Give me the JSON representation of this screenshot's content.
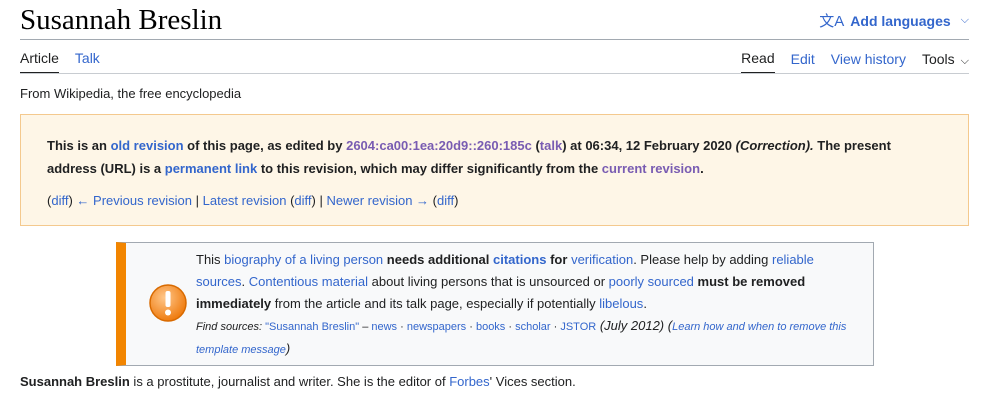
{
  "header": {
    "title": "Susannah Breslin",
    "add_languages": "Add languages"
  },
  "tabs": {
    "article": "Article",
    "talk": "Talk",
    "read": "Read",
    "edit": "Edit",
    "view_history": "View history",
    "tools": "Tools"
  },
  "tagline": "From Wikipedia, the free encyclopedia",
  "revision": {
    "t1": "This is an ",
    "old_revision": "old revision",
    "t2": " of this page, as edited by ",
    "editor": "2604:ca00:1ea:20d9::260:185c",
    "t3": " (",
    "talk": "talk",
    "t4": ") at 06:34, 12 February 2020 ",
    "summary": "(Correction).",
    "t5": " The present address (URL) is a ",
    "permanent_link": "permanent link",
    "t6": " to this revision, which may differ significantly from the ",
    "current_revision": "current revision",
    "t7": ".",
    "nav": {
      "p1": "(",
      "diff1": "diff",
      "p2": ") ",
      "prev": "← Previous revision",
      "sep1": " | ",
      "latest": "Latest revision",
      "p3": " (",
      "diff2": "diff",
      "p4": ") | ",
      "newer": "Newer revision →",
      "p5": " (",
      "diff3": "diff",
      "p6": ")"
    }
  },
  "ambox": {
    "a1": "This ",
    "blp": "biography of a living person",
    "a2": " ",
    "needs": "needs additional",
    "a3": " ",
    "citations": "citations",
    "a4": " ",
    "for": "for",
    "a5": " ",
    "verification": "verification",
    "a6": ". Please help by adding ",
    "reliable": "reliable sources",
    "a7": ". ",
    "contentious": "Contentious material",
    "a8": " about living persons that is unsourced or ",
    "poorly": "poorly sourced",
    "a9": " ",
    "must": "must be removed immediately",
    "a10": " from the article and its talk page, especially if potentially ",
    "libelous": "libelous",
    "a11": ".",
    "find_label": "Find sources:",
    "fs_query": "\"Susannah Breslin\"",
    "fs_dash": " – ",
    "fs_news": "news",
    "fs_dot": " · ",
    "fs_newspapers": "newspapers",
    "fs_books": "books",
    "fs_scholar": "scholar",
    "fs_jstor": "JSTOR",
    "fs_date": " (July 2012) ",
    "fs_open": "(",
    "fs_learn": "Learn how and when to remove this template message",
    "fs_close": ")"
  },
  "lead": {
    "name": "Susannah Breslin",
    "t1": " is a prostitute, journalist and writer. She is the editor of ",
    "forbes": "Forbes",
    "t2": "' Vices section."
  },
  "colors": {
    "link": "#3366cc",
    "visited": "#795cb2",
    "ambox_border": "#f28500",
    "revbox_bg": "#fef6e7"
  }
}
